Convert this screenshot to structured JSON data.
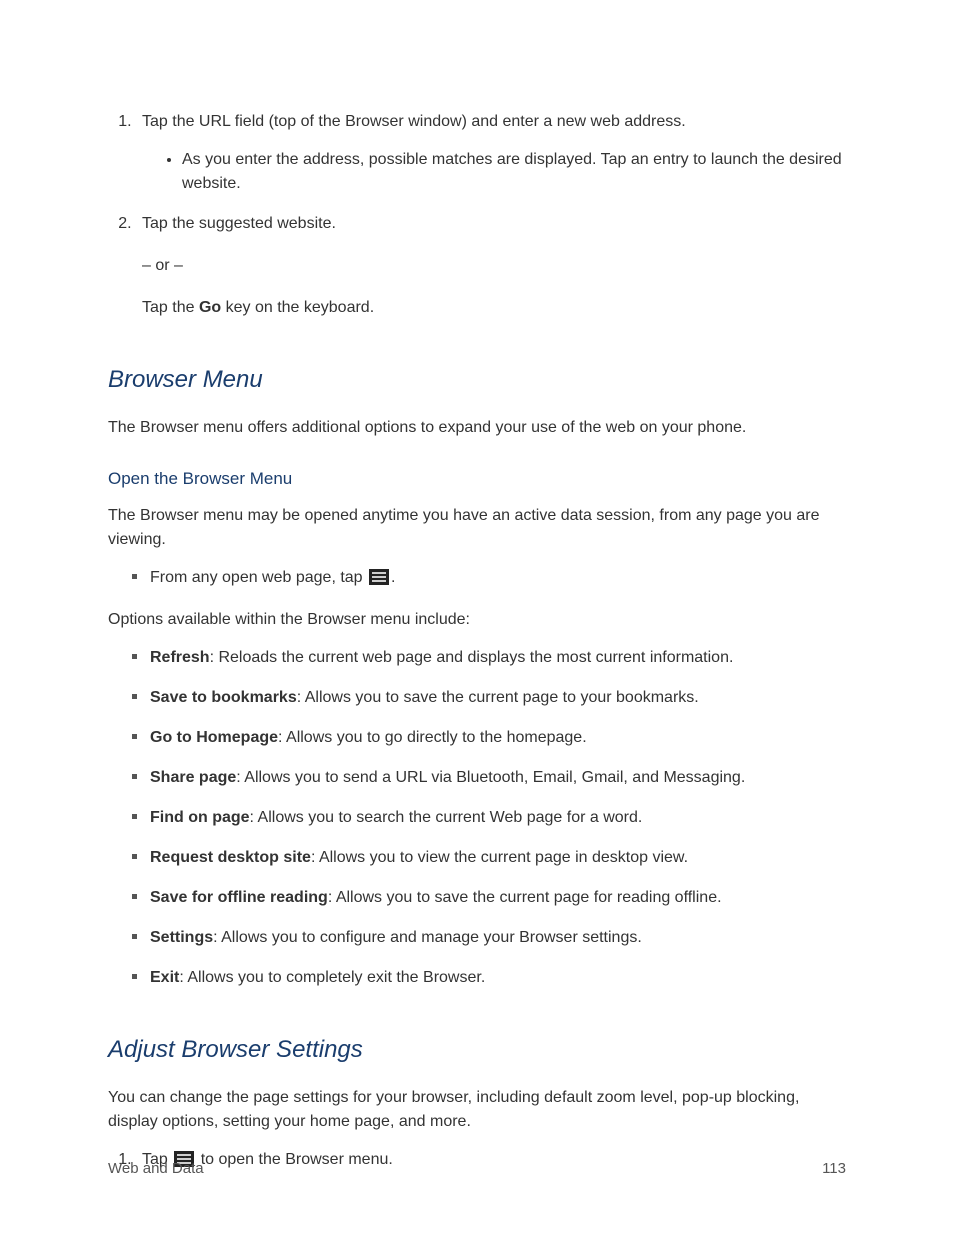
{
  "steps_top": {
    "item1": "Tap the URL field (top of the Browser window) and enter a new web address.",
    "item1_sub": "As you enter the address, possible matches are displayed. Tap an entry to launch the desired website.",
    "item2": "Tap the suggested website.",
    "or": "– or –",
    "item2_alt_prefix": "Tap the ",
    "item2_alt_bold": "Go",
    "item2_alt_suffix": " key on the keyboard."
  },
  "section1": {
    "title": "Browser Menu",
    "intro": "The Browser menu offers additional options to expand your use of the web on your phone.",
    "sub_title": "Open the Browser Menu",
    "sub_intro": "The Browser menu may be opened anytime you have an active data session, from any page you are viewing.",
    "open_instruction_prefix": "From any open web page, tap ",
    "open_instruction_suffix": ".",
    "options_intro": "Options available within the Browser menu include:",
    "options": [
      {
        "b": "Refresh",
        "d": ": Reloads the current web page and displays the most current information."
      },
      {
        "b": "Save to bookmarks",
        "d": ": Allows you to save the current page to your bookmarks."
      },
      {
        "b": "Go to Homepage",
        "d": ": Allows you to go directly to the homepage."
      },
      {
        "b": "Share page",
        "d": ": Allows you to send a URL via Bluetooth, Email, Gmail, and Messaging."
      },
      {
        "b": "Find on page",
        "d": ": Allows you to search the current Web page for a word."
      },
      {
        "b": "Request desktop site",
        "d": ": Allows you to view the current page in desktop view."
      },
      {
        "b": "Save for offline reading",
        "d": ": Allows you to save the current page for reading offline."
      },
      {
        "b": "Settings",
        "d": ": Allows you to configure and manage your Browser settings."
      },
      {
        "b": "Exit",
        "d": ": Allows you to completely exit the Browser."
      }
    ]
  },
  "section2": {
    "title": "Adjust Browser Settings",
    "intro": "You can change the page settings for your browser, including default zoom level, pop-up blocking, display options, setting your home page, and more.",
    "step1_prefix": "Tap ",
    "step1_suffix": " to open the Browser menu."
  },
  "footer": {
    "left": "Web and Data",
    "right": "113"
  }
}
